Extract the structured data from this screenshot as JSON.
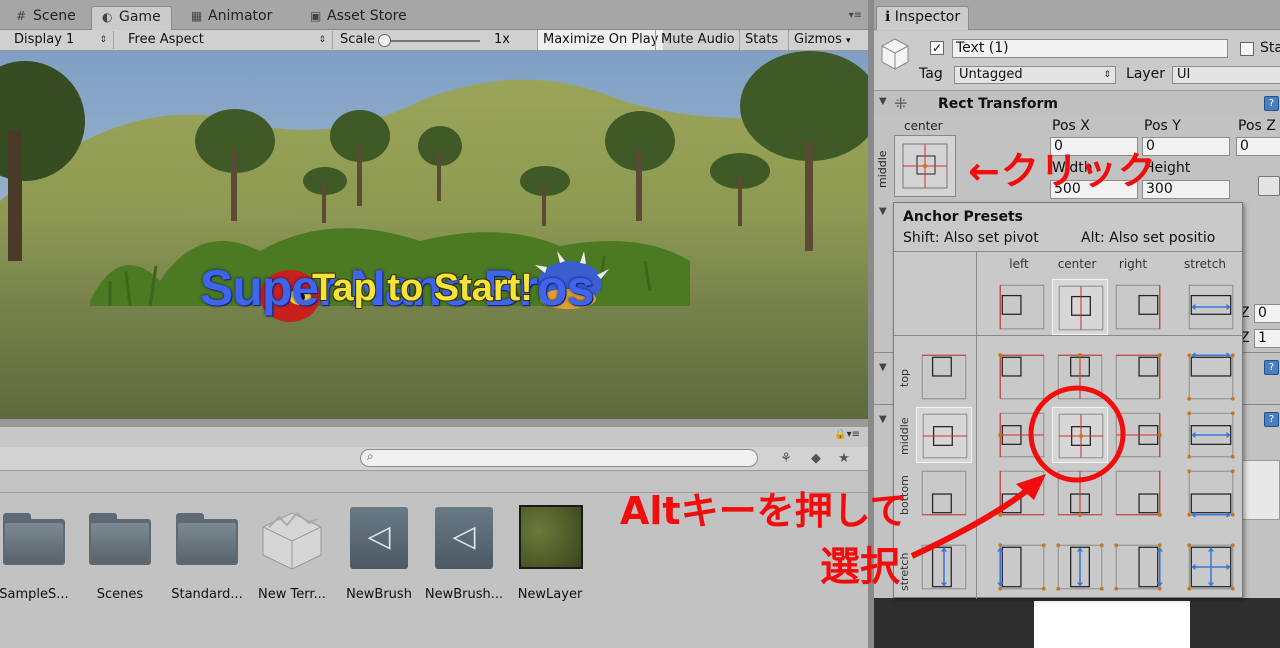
{
  "left_tabs": [
    {
      "icon": "#",
      "label": "Scene"
    },
    {
      "icon": "◐",
      "label": "Game"
    },
    {
      "icon": "▦",
      "label": "Animator"
    },
    {
      "icon": "▣",
      "label": "Asset Store"
    }
  ],
  "game_toolbar": {
    "display": "Display 1",
    "aspect": "Free Aspect",
    "scale_label": "Scale",
    "scale_value": "1x",
    "maximize": "Maximize On Play",
    "mute": "Mute Audio",
    "stats": "Stats",
    "gizmos": "Gizmos"
  },
  "game": {
    "title": "Super Nano Bros",
    "tap_to_start": "Tap to Start!"
  },
  "project": {
    "assets": [
      {
        "label": "SampleS...",
        "kind": "folder"
      },
      {
        "label": "Scenes",
        "kind": "folder"
      },
      {
        "label": "Standard...",
        "kind": "folder"
      },
      {
        "label": "New Terr...",
        "kind": "terrain"
      },
      {
        "label": "NewBrush",
        "kind": "unity"
      },
      {
        "label": "NewBrush...",
        "kind": "unity"
      },
      {
        "label": "NewLayer",
        "kind": "texture"
      }
    ]
  },
  "inspector": {
    "tab": "Inspector",
    "tab_icon": "ℹ",
    "object_name": "Text (1)",
    "static_label": "Sta",
    "tag_label": "Tag",
    "tag_value": "Untagged",
    "layer_label": "Layer",
    "layer_value": "UI",
    "rect_transform_title": "Rect Transform",
    "anchor_h": "center",
    "anchor_v": "middle",
    "pos_x_label": "Pos X",
    "pos_x": "0",
    "pos_y_label": "Pos Y",
    "pos_y": "0",
    "pos_z_label": "Pos Z",
    "pos_z": "0",
    "width_label": "Width",
    "width": "500",
    "height_label": "Height",
    "height": "300",
    "z_label_1": "Z",
    "z_value_1": "0",
    "z_label_2": "Z",
    "z_value_2": "1"
  },
  "presets": {
    "title": "Anchor Presets",
    "hint_shift": "Shift: Also set pivot",
    "hint_alt": "Alt: Also set positio",
    "columns": [
      "left",
      "center",
      "right",
      "stretch"
    ],
    "rows": [
      "top",
      "middle",
      "bottom",
      "stretch"
    ]
  },
  "annotations": {
    "click": "←クリック",
    "alt": "Altキーを押して",
    "select": "選択"
  },
  "colors": {
    "annotation": "#f20c0c",
    "title_blue": "#3f64ee",
    "tap_yellow": "#f4e33a",
    "anchor_red": "#d03030",
    "anchor_blue": "#3a78d8",
    "anchor_orange": "#c07a1a"
  }
}
